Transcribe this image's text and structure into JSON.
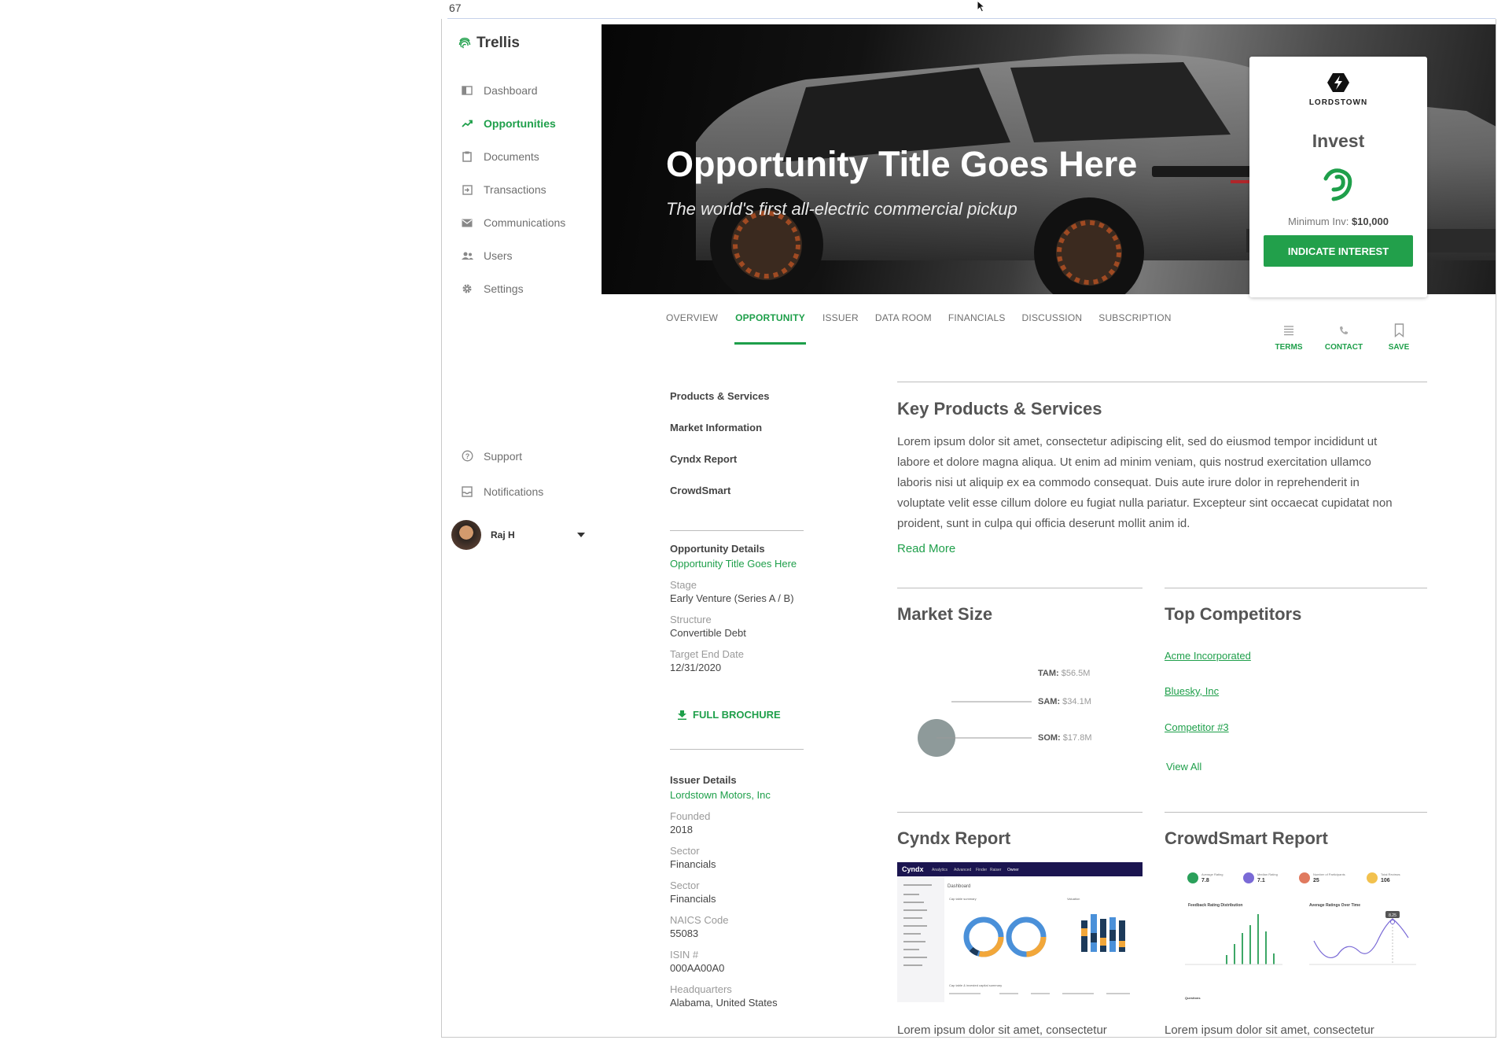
{
  "page_number": "67",
  "brand": {
    "name": "Trellis"
  },
  "nav": {
    "items": [
      {
        "label": "Dashboard",
        "icon": "dashboard-icon"
      },
      {
        "label": "Opportunities",
        "icon": "trending-up-icon"
      },
      {
        "label": "Documents",
        "icon": "clipboard-icon"
      },
      {
        "label": "Transactions",
        "icon": "exit-to-app-icon"
      },
      {
        "label": "Communications",
        "icon": "mail-icon"
      },
      {
        "label": "Users",
        "icon": "people-icon"
      },
      {
        "label": "Settings",
        "icon": "gear-icon"
      }
    ],
    "active": "Opportunities",
    "support": "Support",
    "notifications": "Notifications"
  },
  "user": {
    "name": "Raj H"
  },
  "hero": {
    "title": "Opportunity Title Goes Here",
    "subtitle": "The world's first all-electric commercial pickup"
  },
  "invest_card": {
    "logo_text": "LORDSTOWN",
    "title": "Invest",
    "min_label": "Minimum Inv:",
    "min_value": "$10,000",
    "cta": "INDICATE INTEREST"
  },
  "tabs": [
    "OVERVIEW",
    "OPPORTUNITY",
    "ISSUER",
    "DATA ROOM",
    "FINANCIALS",
    "DISCUSSION",
    "SUBSCRIPTION"
  ],
  "active_tab": "OPPORTUNITY",
  "actions": {
    "terms": "TERMS",
    "contact": "CONTACT",
    "save": "SAVE"
  },
  "subnav": [
    "Products & Services",
    "Market Information",
    "Cyndx Report",
    "CrowdSmart"
  ],
  "opportunity_details": {
    "heading": "Opportunity Details",
    "title_link": "Opportunity Title Goes Here",
    "stage_label": "Stage",
    "stage": "Early Venture (Series A / B)",
    "structure_label": "Structure",
    "structure": "Convertible Debt",
    "end_label": "Target End Date",
    "end_date": "12/31/2020",
    "brochure": "FULL BROCHURE"
  },
  "issuer_details": {
    "heading": "Issuer Details",
    "issuer_link": "Lordstown Motors, Inc",
    "founded_label": "Founded",
    "founded": "2018",
    "sector_label": "Sector",
    "sector": "Financials",
    "sector2_label": "Sector",
    "sector2": "Financials",
    "naics_label": "NAICS Code",
    "naics": "55083",
    "isin_label": "ISIN #",
    "isin": "000AA00A0",
    "hq_label": "Headquarters",
    "hq": "Alabama, United States"
  },
  "key_products": {
    "title": "Key Products & Services",
    "body": "Lorem ipsum dolor sit amet, consectetur adipiscing elit, sed do eiusmod tempor incididunt ut labore et dolore magna aliqua. Ut enim ad minim veniam, quis nostrud exercitation ullamco laboris nisi ut aliquip ex ea commodo consequat. Duis aute irure dolor in reprehenderit in voluptate velit esse cillum dolore eu fugiat nulla pariatur. Excepteur sint occaecat cupidatat non proident, sunt in culpa qui officia deserunt mollit anim id.",
    "read_more": "Read More"
  },
  "market_size": {
    "title": "Market Size",
    "tam_label": "TAM:",
    "tam_value": "$56.5M",
    "sam_label": "SAM:",
    "sam_value": "$34.1M",
    "som_label": "SOM:",
    "som_value": "$17.8M"
  },
  "competitors": {
    "title": "Top Competitors",
    "items": [
      "Acme Incorporated",
      "Bluesky, Inc",
      "Competitor #3"
    ],
    "view_all": "View All"
  },
  "cyndx": {
    "title": "Cyndx Report",
    "teaser": "Lorem ipsum dolor sit amet, consectetur",
    "thumb": {
      "brand": "Cyndx",
      "menu": [
        "Analytics",
        "Advanced",
        "Finder",
        "Raiser",
        "Owner"
      ],
      "page": "Dashboard",
      "panel1": "Cap table summary",
      "panel2": "Valuation",
      "footer": "Cap table & invested capital summary"
    }
  },
  "crowdsmart": {
    "title": "CrowdSmart Report",
    "teaser": "Lorem ipsum dolor sit amet, consectetur",
    "thumb": {
      "stats": [
        {
          "label": "Average Rating",
          "value": "7.8"
        },
        {
          "label": "Median Rating",
          "value": "7.1"
        },
        {
          "label": "Number of Participants",
          "value": "25"
        },
        {
          "label": "Total Reviews",
          "value": "106"
        }
      ],
      "chart1": "Feedback Rating Distribution",
      "chart2": "Average Ratings Over Time",
      "badge": "8.25",
      "footer": "Questions"
    }
  },
  "colors": {
    "accent": "#1e9f4a",
    "button": "#22a04b",
    "muted": "#9a9a9a"
  }
}
